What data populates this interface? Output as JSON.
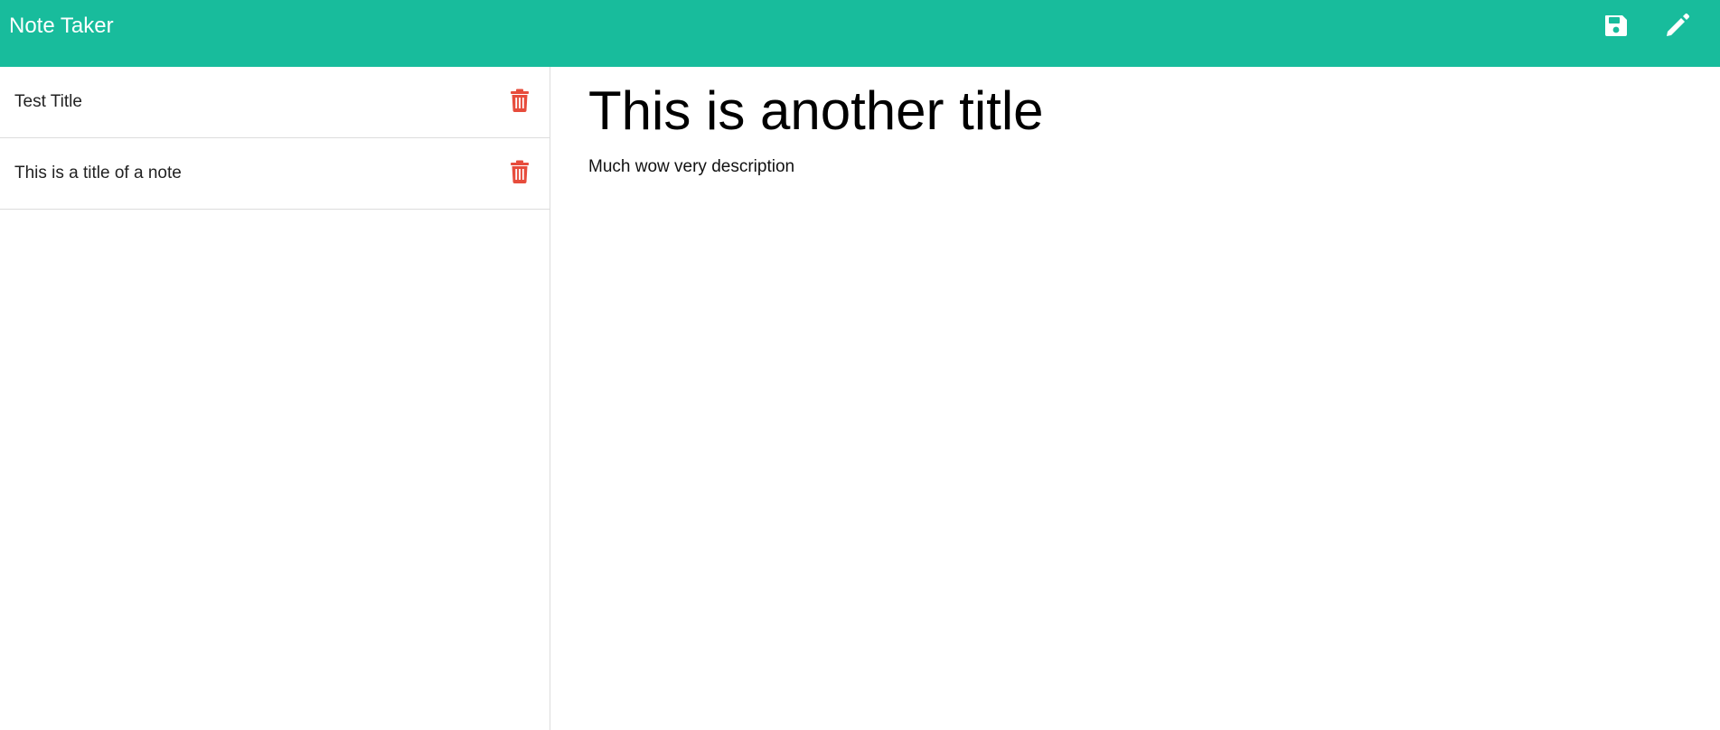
{
  "app": {
    "title": "Note Taker",
    "accent_color": "#18bc9c",
    "delete_color": "#e74c3c"
  },
  "toolbar": {
    "save_icon": "floppy-disk-icon",
    "new_note_icon": "pencil-icon"
  },
  "sidebar": {
    "notes": [
      {
        "title": "Test Title",
        "delete_icon": "trash-icon"
      },
      {
        "title": "This is a title of a note",
        "delete_icon": "trash-icon"
      }
    ]
  },
  "main": {
    "note_title": "This is another title",
    "note_text": "Much wow very description"
  }
}
